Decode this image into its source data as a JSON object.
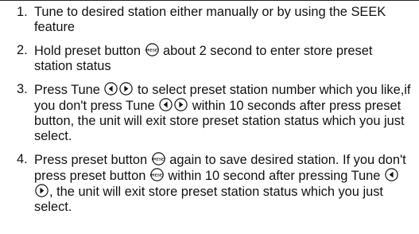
{
  "steps": [
    {
      "number": "1.",
      "segments": [
        {
          "text": "Tune to desired station either manually or by using the SEEK feature"
        }
      ]
    },
    {
      "number": "2.",
      "segments": [
        {
          "text": "Hold preset button "
        },
        {
          "icon": "preset-button-icon"
        },
        {
          "text": " about 2 second to enter store preset station status"
        }
      ]
    },
    {
      "number": "3.",
      "segments": [
        {
          "text": "Press Tune "
        },
        {
          "icon": "tune-left-icon"
        },
        {
          "icon": "tune-right-icon"
        },
        {
          "text": " to select preset station number which you like,if you don't press Tune "
        },
        {
          "icon": "tune-left-icon"
        },
        {
          "icon": "tune-right-icon"
        },
        {
          "text": " within 10 seconds after press preset button, the unit will exit store preset station status which you just select."
        }
      ]
    },
    {
      "number": "4.",
      "segments": [
        {
          "text": "Press preset button "
        },
        {
          "icon": "preset-button-icon"
        },
        {
          "text": " again to save desired station. If you don't press preset button "
        },
        {
          "icon": "preset-button-icon"
        },
        {
          "text": " within 10 second after pressing Tune "
        },
        {
          "icon": "tune-left-icon"
        },
        {
          "icon": "tune-right-icon"
        },
        {
          "text": ", the unit will exit store preset station status which you just select."
        }
      ]
    }
  ],
  "icon_glyph_text": {
    "preset-button-icon": "PRESET"
  }
}
